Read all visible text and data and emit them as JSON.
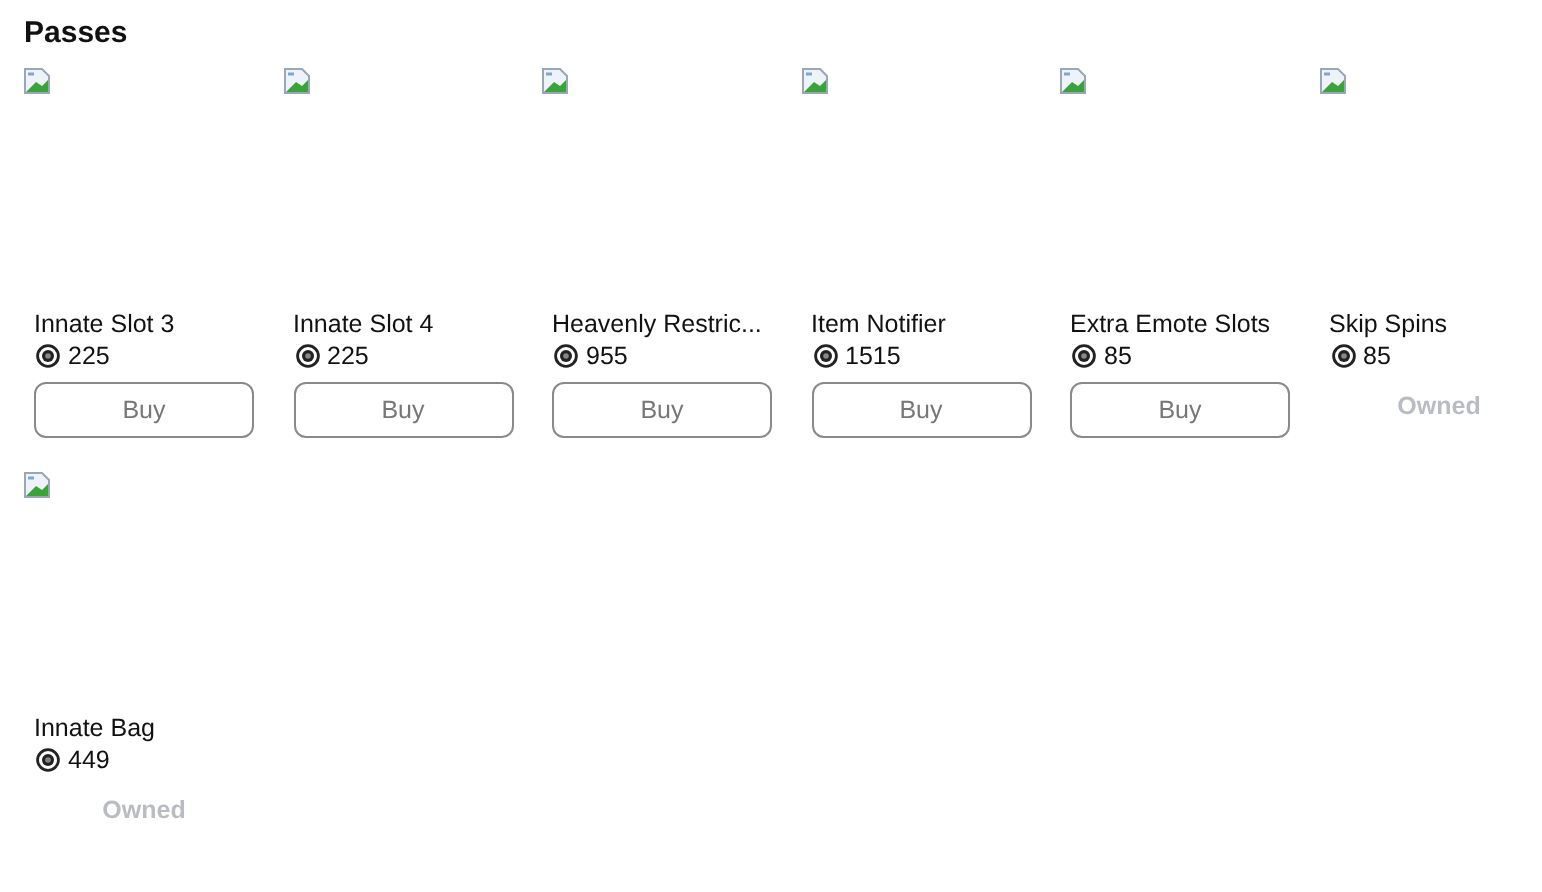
{
  "title": "Passes",
  "passes": [
    {
      "name": "Innate Slot 3",
      "price": "225",
      "action": "Buy",
      "owned": false
    },
    {
      "name": "Innate Slot 4",
      "price": "225",
      "action": "Buy",
      "owned": false
    },
    {
      "name": "Heavenly Restric...",
      "price": "955",
      "action": "Buy",
      "owned": false
    },
    {
      "name": "Item Notifier",
      "price": "1515",
      "action": "Buy",
      "owned": false
    },
    {
      "name": "Extra Emote Slots",
      "price": "85",
      "action": "Buy",
      "owned": false
    },
    {
      "name": "Skip Spins",
      "price": "85",
      "action": "Owned",
      "owned": true
    },
    {
      "name": "Innate Bag",
      "price": "449",
      "action": "Owned",
      "owned": true
    }
  ]
}
